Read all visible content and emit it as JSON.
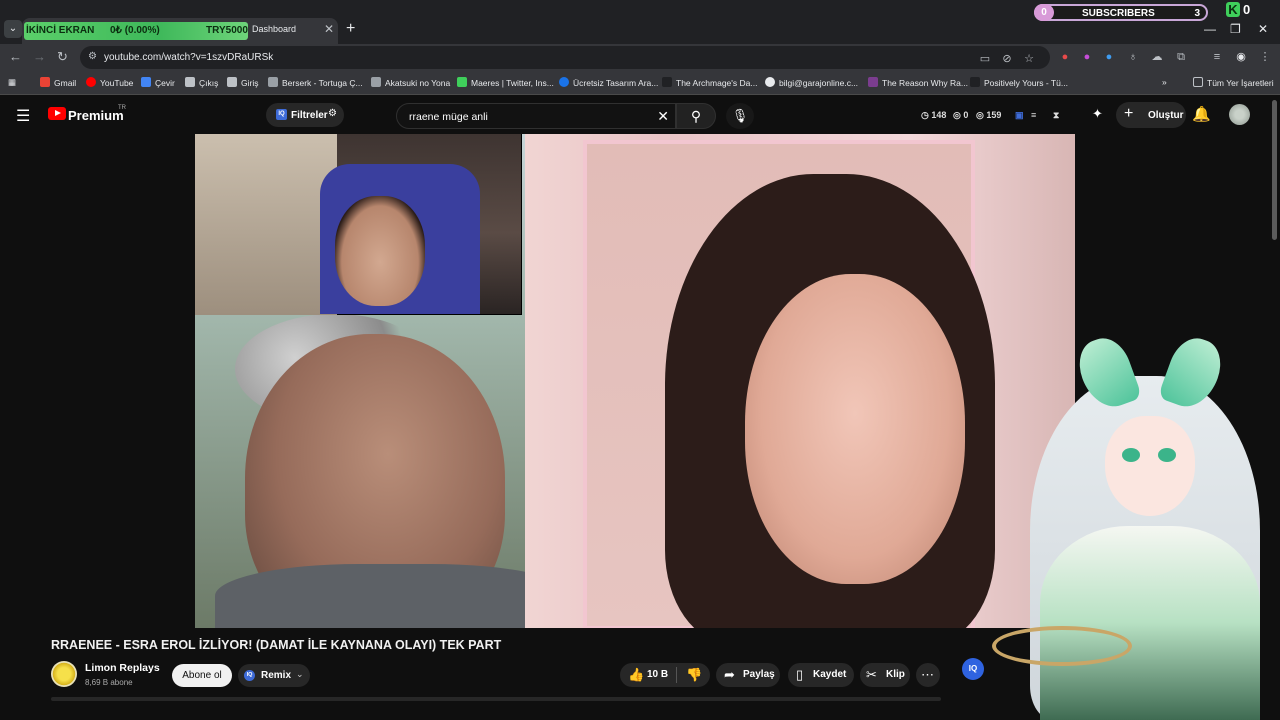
{
  "browser": {
    "tab_title": "Dashboard",
    "overlay": {
      "left": "İKİNCİ EKRAN",
      "mid": "0₺ (0.00%)",
      "right": "TRY5000"
    },
    "subscribers_widget": {
      "left_count": "0",
      "label": "SUBSCRIBERS",
      "count": "3"
    },
    "k_widget": {
      "letter": "K",
      "count": "0"
    },
    "url": "youtube.com/watch?v=1szvDRaURSk",
    "bookmarks": [
      {
        "label": "Gmail",
        "color": "#ea4335"
      },
      {
        "label": "YouTube",
        "color": "#ff0000"
      },
      {
        "label": "Çevir",
        "color": "#4285f4"
      },
      {
        "label": "Çıkış",
        "color": "#bdc1c6"
      },
      {
        "label": "Giriş",
        "color": "#bdc1c6"
      },
      {
        "label": "Berserk - Tortuga Ç...",
        "color": "#9aa0a6"
      },
      {
        "label": "Akatsuki no Yona",
        "color": "#9aa0a6"
      },
      {
        "label": "Maeres | Twitter, Ins...",
        "color": "#3fcf5b"
      },
      {
        "label": "Ücretsiz Tasarım Ara...",
        "color": "#1a73e8"
      },
      {
        "label": "The Archmage's Da...",
        "color": "#202124"
      },
      {
        "label": "bilgi@garajonline.c...",
        "color": "#e8eaed"
      },
      {
        "label": "The Reason Why Ra...",
        "color": "#7b3d8f"
      },
      {
        "label": "Positively Yours - Tü...",
        "color": "#202124"
      }
    ],
    "all_bookmarks": "Tüm Yer İşaretleri"
  },
  "youtube": {
    "brand": "Premium",
    "region": "TR",
    "filters_label": "Filtreler",
    "filters_badge": "IQ",
    "search_value": "rraene müge anli",
    "stats": {
      "views": "148",
      "mid": "0",
      "right": "159"
    },
    "create_label": "Oluştur",
    "video": {
      "title": "RRAENEE - ESRA EROL İZLİYOR! (DAMAT İLE KAYNANA OLAYI) TEK PART",
      "channel": "Limon Replays",
      "subscribers": "8,69 B abone",
      "subscribe_label": "Abone ol",
      "remix_label": "Remix",
      "remix_badge": "IQ",
      "likes": "10 B",
      "share_label": "Paylaş",
      "save_label": "Kaydet",
      "clip_label": "Klip",
      "iq_badge": "IQ"
    }
  }
}
